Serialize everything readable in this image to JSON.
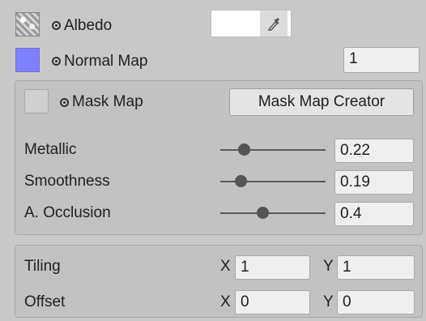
{
  "albedo": {
    "label": "Albedo",
    "color": "#ffffff"
  },
  "normal_map": {
    "label": "Normal Map",
    "value": "1",
    "swatch_color": "#7f80ff"
  },
  "mask_map": {
    "label": "Mask Map",
    "button_label": "Mask Map Creator"
  },
  "sliders": [
    {
      "label": "Metallic",
      "value": "0.22",
      "fraction": 0.22
    },
    {
      "label": "Smoothness",
      "value": "0.19",
      "fraction": 0.19
    },
    {
      "label": "A. Occlusion",
      "value": "0.4",
      "fraction": 0.4
    }
  ],
  "tiling": {
    "label": "Tiling",
    "x_label": "X",
    "x": "1",
    "y_label": "Y",
    "y": "1"
  },
  "offset": {
    "label": "Offset",
    "x_label": "X",
    "x": "0",
    "y_label": "Y",
    "y": "0"
  }
}
